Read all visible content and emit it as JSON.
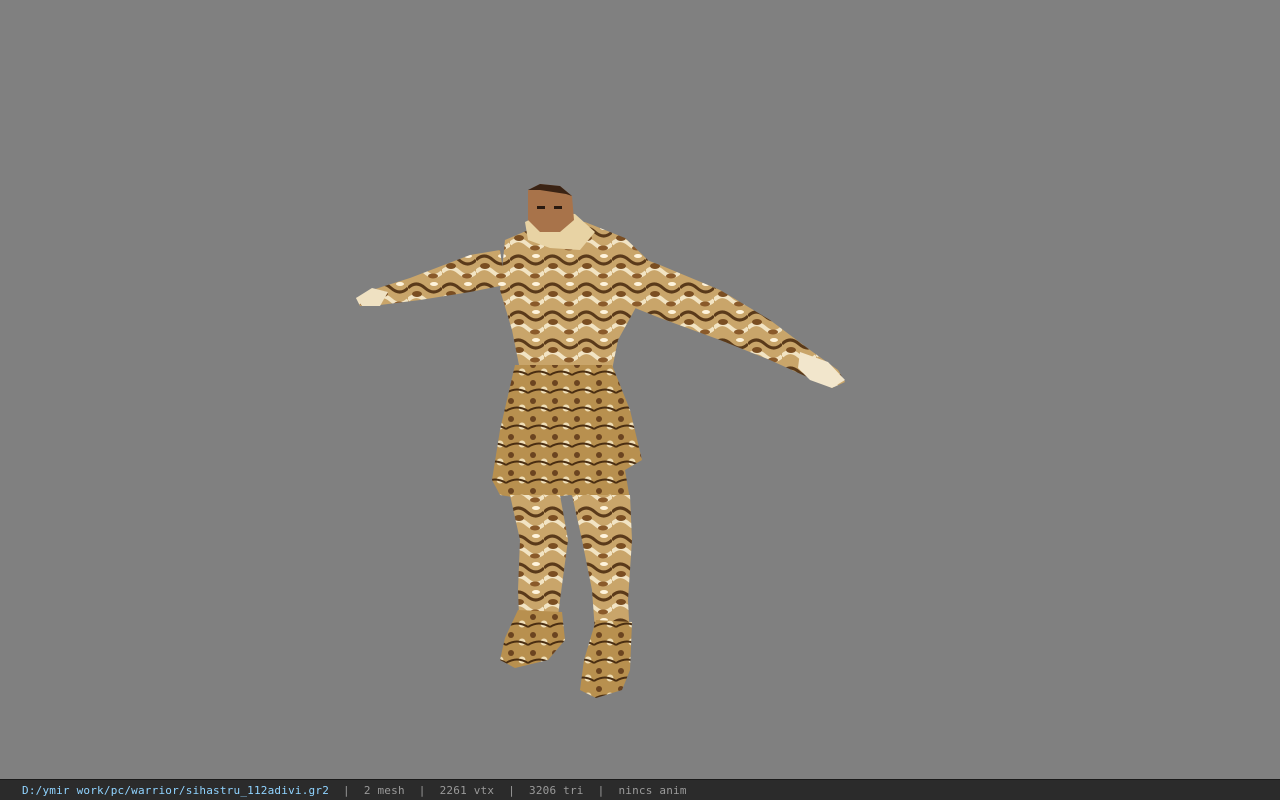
{
  "viewport": {
    "background": "#808080",
    "model_name": "",
    "pose": "t-pose"
  },
  "statusbar": {
    "file_path": "D:/ymir work/pc/warrior/sihastru_112adivi.gr2",
    "separator": "|",
    "mesh": "2 mesh",
    "vtx": "2261 vtx",
    "tri": "3206 tri",
    "anim": "nincs anim",
    "path_color": "#8fd3ff",
    "text_color": "#9a9a9a",
    "background": "#2b2b2b"
  }
}
